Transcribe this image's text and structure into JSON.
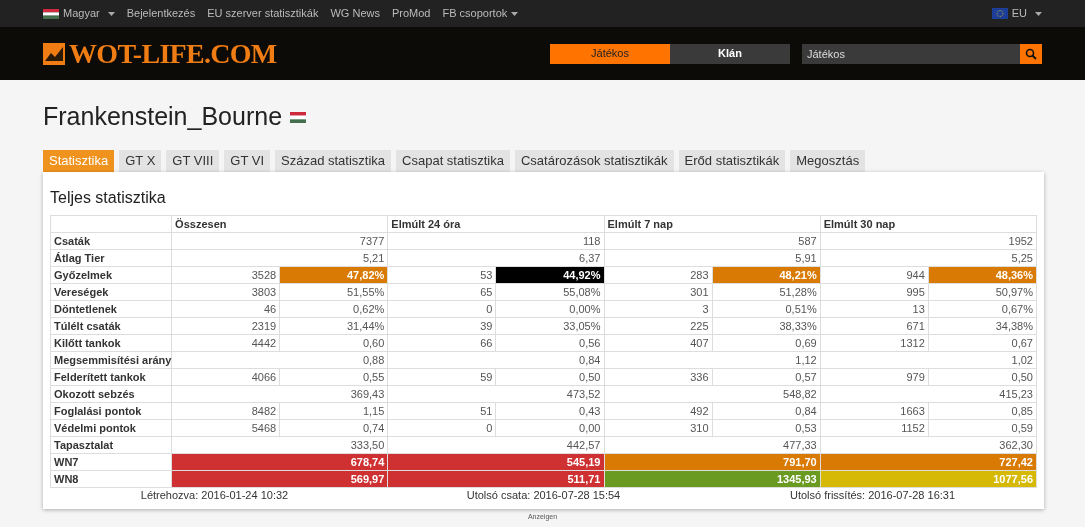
{
  "topbar": {
    "language": "Magyar",
    "links": [
      {
        "label": "Bejelentkezés",
        "dropdown": false
      },
      {
        "label": "EU szerver statisztikák",
        "dropdown": false
      },
      {
        "label": "WG News",
        "dropdown": false
      },
      {
        "label": "ProMod",
        "dropdown": false
      },
      {
        "label": "FB csoportok",
        "dropdown": true
      }
    ],
    "region": "EU"
  },
  "header": {
    "logo": "WOT-LIFE.COM",
    "modes": [
      {
        "label": "Játékos",
        "selected": true
      },
      {
        "label": "Klán",
        "selected": false
      }
    ],
    "search": {
      "placeholder": "Játékos"
    }
  },
  "player": {
    "name": "Frankenstein_Bourne"
  },
  "tabs": [
    {
      "label": "Statisztika",
      "selected": true
    },
    {
      "label": "GT X",
      "selected": false
    },
    {
      "label": "GT VIII",
      "selected": false
    },
    {
      "label": "GT VI",
      "selected": false
    },
    {
      "label": "Század statisztika",
      "selected": false
    },
    {
      "label": "Csapat statisztika",
      "selected": false
    },
    {
      "label": "Csatározások statisztikák",
      "selected": false
    },
    {
      "label": "Erőd statisztikák",
      "selected": false
    },
    {
      "label": "Megosztás",
      "selected": false
    }
  ],
  "panel": {
    "title": "Teljes statisztika",
    "columns": [
      "Összesen",
      "Elmúlt 24 óra",
      "Elmúlt 7 nap",
      "Elmúlt 30 nap"
    ],
    "rows": [
      {
        "label": "Csaták",
        "periods": [
          {
            "value": "7377"
          },
          {
            "value": "118"
          },
          {
            "value": "587"
          },
          {
            "value": "1952"
          }
        ]
      },
      {
        "label": "Átlag Tier",
        "periods": [
          {
            "value": "5,21"
          },
          {
            "value": "6,37"
          },
          {
            "value": "5,91"
          },
          {
            "value": "5,25"
          }
        ]
      },
      {
        "label": "Győzelmek",
        "periods": [
          {
            "count": "3528",
            "value": "47,82%",
            "color": "#d97a05"
          },
          {
            "count": "53",
            "value": "44,92%",
            "color": "#000000"
          },
          {
            "count": "283",
            "value": "48,21%",
            "color": "#d97a05"
          },
          {
            "count": "944",
            "value": "48,36%",
            "color": "#d97a05"
          }
        ]
      },
      {
        "label": "Vereségek",
        "periods": [
          {
            "count": "3803",
            "value": "51,55%"
          },
          {
            "count": "65",
            "value": "55,08%"
          },
          {
            "count": "301",
            "value": "51,28%"
          },
          {
            "count": "995",
            "value": "50,97%"
          }
        ]
      },
      {
        "label": "Döntetlenek",
        "periods": [
          {
            "count": "46",
            "value": "0,62%"
          },
          {
            "count": "0",
            "value": "0,00%"
          },
          {
            "count": "3",
            "value": "0,51%"
          },
          {
            "count": "13",
            "value": "0,67%"
          }
        ]
      },
      {
        "label": "Túlélt csaták",
        "periods": [
          {
            "count": "2319",
            "value": "31,44%"
          },
          {
            "count": "39",
            "value": "33,05%"
          },
          {
            "count": "225",
            "value": "38,33%"
          },
          {
            "count": "671",
            "value": "34,38%"
          }
        ]
      },
      {
        "label": "Kilőtt tankok",
        "periods": [
          {
            "count": "4442",
            "value": "0,60"
          },
          {
            "count": "66",
            "value": "0,56"
          },
          {
            "count": "407",
            "value": "0,69"
          },
          {
            "count": "1312",
            "value": "0,67"
          }
        ]
      },
      {
        "label": "Megsemmisítési arány",
        "periods": [
          {
            "value": "0,88"
          },
          {
            "value": "0,84"
          },
          {
            "value": "1,12"
          },
          {
            "value": "1,02"
          }
        ]
      },
      {
        "label": "Felderített tankok",
        "periods": [
          {
            "count": "4066",
            "value": "0,55"
          },
          {
            "count": "59",
            "value": "0,50"
          },
          {
            "count": "336",
            "value": "0,57"
          },
          {
            "count": "979",
            "value": "0,50"
          }
        ]
      },
      {
        "label": "Okozott sebzés",
        "periods": [
          {
            "value": "369,43"
          },
          {
            "value": "473,52"
          },
          {
            "value": "548,82"
          },
          {
            "value": "415,23"
          }
        ]
      },
      {
        "label": "Foglalási pontok",
        "periods": [
          {
            "count": "8482",
            "value": "1,15"
          },
          {
            "count": "51",
            "value": "0,43"
          },
          {
            "count": "492",
            "value": "0,84"
          },
          {
            "count": "1663",
            "value": "0,85"
          }
        ]
      },
      {
        "label": "Védelmi pontok",
        "periods": [
          {
            "count": "5468",
            "value": "0,74"
          },
          {
            "count": "0",
            "value": "0,00"
          },
          {
            "count": "310",
            "value": "0,53"
          },
          {
            "count": "1152",
            "value": "0,59"
          }
        ]
      },
      {
        "label": "Tapasztalat",
        "periods": [
          {
            "value": "333,50"
          },
          {
            "value": "442,57"
          },
          {
            "value": "477,33"
          },
          {
            "value": "362,30"
          }
        ]
      },
      {
        "label": "WN7",
        "periods": [
          {
            "value": "678,74",
            "color": "#cf3132"
          },
          {
            "value": "545,19",
            "color": "#cf3132"
          },
          {
            "value": "791,70",
            "color": "#d97a05"
          },
          {
            "value": "727,42",
            "color": "#d97a05"
          }
        ]
      },
      {
        "label": "WN8",
        "periods": [
          {
            "value": "569,97",
            "color": "#cf3132"
          },
          {
            "value": "511,71",
            "color": "#cf3132"
          },
          {
            "value": "1345,93",
            "color": "#6b9a21"
          },
          {
            "value": "1077,56",
            "color": "#d6b807"
          }
        ]
      }
    ],
    "footer": [
      "Létrehozva: 2016-01-24 10:32",
      "Utolsó csata: 2016-07-28 15:54",
      "Utolsó frissítés: 2016-07-28 16:31"
    ]
  },
  "ad_label": "Anzeigen"
}
